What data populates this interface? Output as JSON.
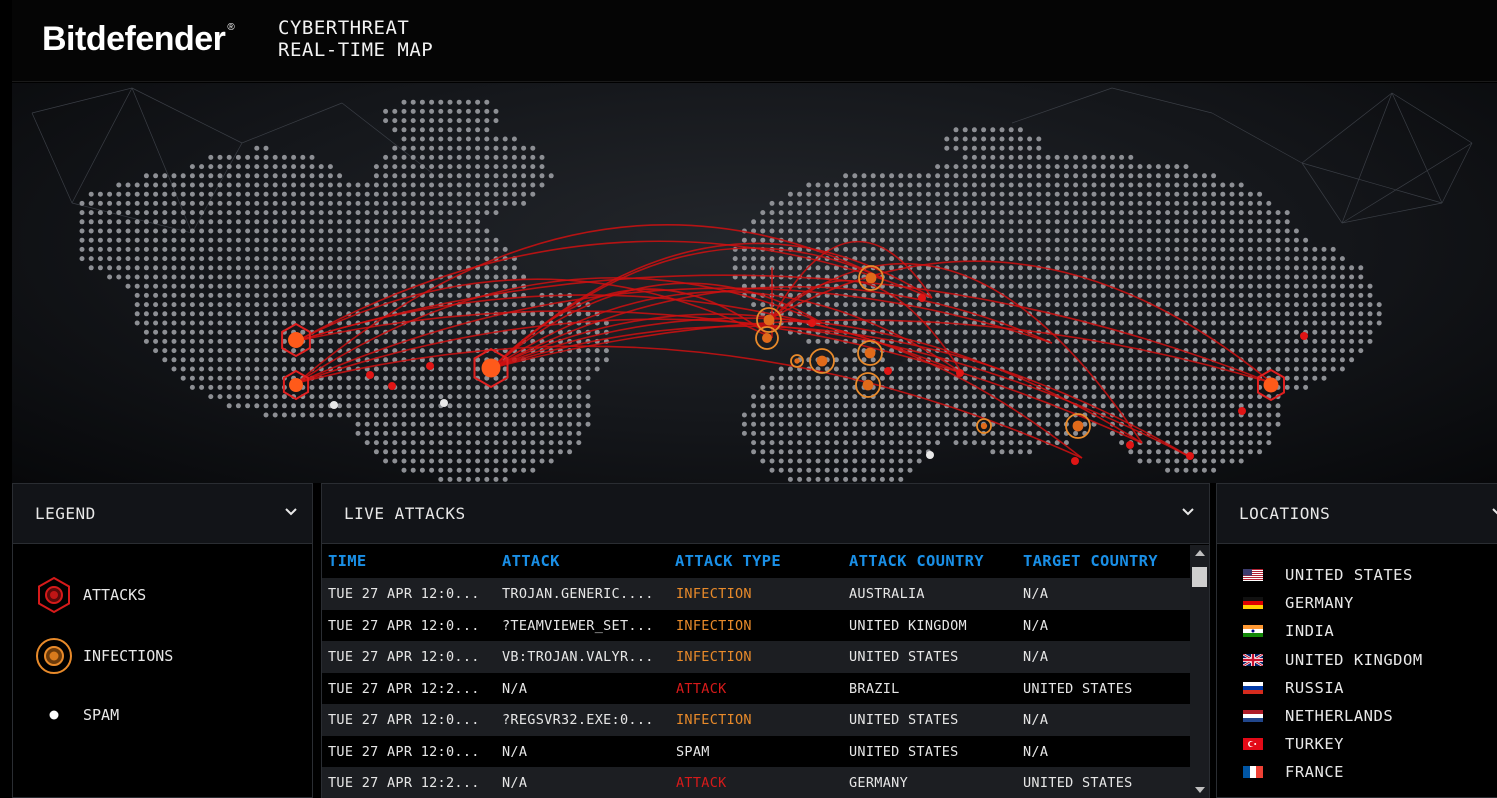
{
  "brand": {
    "name": "Bitdefender",
    "mark": "®"
  },
  "app_title": "CYBERTHREAT\nREAL-TIME MAP",
  "colors": {
    "attack": "#d61a1a",
    "infection": "#e88a2a",
    "spam": "#ffffff",
    "header_blue": "#1a8fe6"
  },
  "legend": {
    "title": "LEGEND",
    "items": [
      {
        "label": "ATTACKS",
        "icon": "attack-hexagon-icon"
      },
      {
        "label": "INFECTIONS",
        "icon": "infection-circle-icon"
      },
      {
        "label": "SPAM",
        "icon": "spam-dot-icon"
      }
    ]
  },
  "live_attacks": {
    "title": "LIVE ATTACKS",
    "columns": [
      "TIME",
      "ATTACK",
      "ATTACK TYPE",
      "ATTACK COUNTRY",
      "TARGET COUNTRY"
    ],
    "rows": [
      {
        "time": "TUE 27 APR 12:0...",
        "attack": "TROJAN.GENERIC....",
        "type": "INFECTION",
        "attack_country": "AUSTRALIA",
        "target_country": "N/A"
      },
      {
        "time": "TUE 27 APR 12:0...",
        "attack": "?TEAMVIEWER_SET...",
        "type": "INFECTION",
        "attack_country": "UNITED KINGDOM",
        "target_country": "N/A"
      },
      {
        "time": "TUE 27 APR 12:0...",
        "attack": "VB:TROJAN.VALYR...",
        "type": "INFECTION",
        "attack_country": "UNITED STATES",
        "target_country": "N/A"
      },
      {
        "time": "TUE 27 APR 12:2...",
        "attack": "N/A",
        "type": "ATTACK",
        "attack_country": "BRAZIL",
        "target_country": "UNITED STATES"
      },
      {
        "time": "TUE 27 APR 12:0...",
        "attack": "?REGSVR32.EXE:0...",
        "type": "INFECTION",
        "attack_country": "UNITED STATES",
        "target_country": "N/A"
      },
      {
        "time": "TUE 27 APR 12:0...",
        "attack": "N/A",
        "type": "SPAM",
        "attack_country": "UNITED STATES",
        "target_country": "N/A"
      },
      {
        "time": "TUE 27 APR 12:2...",
        "attack": "N/A",
        "type": "ATTACK",
        "attack_country": "GERMANY",
        "target_country": "UNITED STATES"
      }
    ]
  },
  "locations": {
    "title": "LOCATIONS",
    "items": [
      {
        "label": "UNITED STATES",
        "flag": "us-flag-icon"
      },
      {
        "label": "GERMANY",
        "flag": "de-flag-icon"
      },
      {
        "label": "INDIA",
        "flag": "in-flag-icon"
      },
      {
        "label": "UNITED KINGDOM",
        "flag": "gb-flag-icon"
      },
      {
        "label": "RUSSIA",
        "flag": "ru-flag-icon"
      },
      {
        "label": "NETHERLANDS",
        "flag": "nl-flag-icon"
      },
      {
        "label": "TURKEY",
        "flag": "tr-flag-icon"
      },
      {
        "label": "FRANCE",
        "flag": "fr-flag-icon"
      }
    ]
  }
}
